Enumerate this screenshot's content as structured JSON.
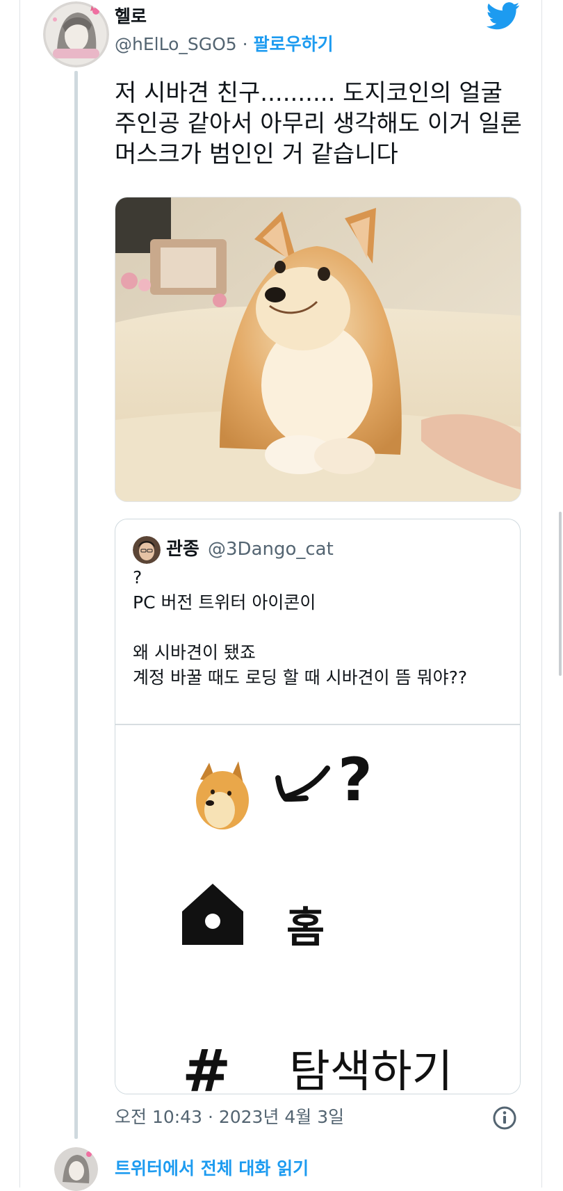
{
  "author": {
    "display_name": "헬로",
    "handle": "@hElLo_SGO5",
    "separator": "·",
    "follow_label": "팔로우하기"
  },
  "tweet": {
    "text": "저 시바견 친구.......... 도지코인의 얼굴 주인공 같아서 아무리 생각해도 이거 일론머스크가 범인인 거 같습니다"
  },
  "quote": {
    "display_name": "관종",
    "handle": "@3Dango_cat",
    "lines": [
      "?",
      "PC 버전 트위터 아이콘이",
      "왜 시바견이 됐죠",
      "계정 바꿀 때도 로딩 할 때 시바견이 뜸 뭐야??"
    ],
    "image_labels": {
      "question": "?",
      "home": "홈",
      "explore": "탐색하기"
    }
  },
  "meta": {
    "timestamp": "오전 10:43 · 2023년 4월 3일",
    "read_conversation": "트위터에서 전체 대화 읽기"
  },
  "icons": {
    "logo": "twitter-bird-icon",
    "info": "info-icon",
    "home": "home-icon",
    "hash": "hashtag-icon",
    "arrow": "arrow-icon"
  },
  "colors": {
    "accent": "#1d9bf0",
    "secondary_text": "#536471",
    "border": "#cfd9de"
  }
}
